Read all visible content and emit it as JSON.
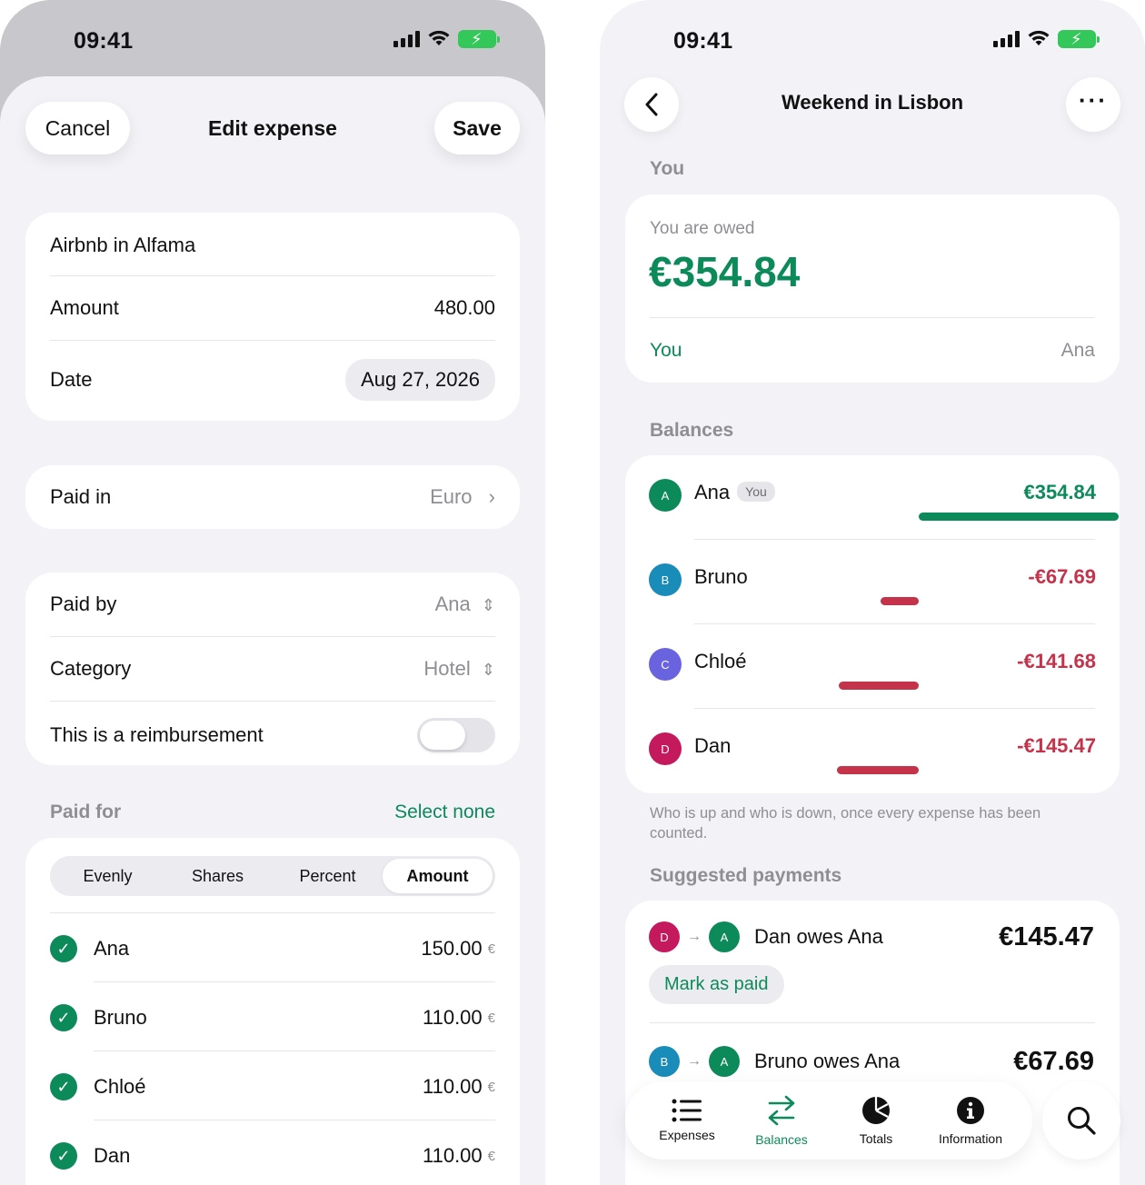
{
  "left": {
    "status": {
      "time": "09:41"
    },
    "header": {
      "cancel_label": "Cancel",
      "title": "Edit expense",
      "save_label": "Save"
    },
    "expense": {
      "title": "Airbnb in Alfama",
      "amount_label": "Amount",
      "amount_value": "480.00",
      "date_label": "Date",
      "date_value": "Aug 27, 2026"
    },
    "paid_in": {
      "label": "Paid in",
      "value": "Euro"
    },
    "details": {
      "paid_by_label": "Paid by",
      "paid_by_value": "Ana",
      "category_label": "Category",
      "category_value": "Hotel",
      "reimbursement_label": "This is a reimbursement",
      "reimbursement_on": false
    },
    "paid_for": {
      "label": "Paid for",
      "select_none": "Select none",
      "modes": [
        "Evenly",
        "Shares",
        "Percent",
        "Amount"
      ],
      "selected_mode": "Amount",
      "currency_symbol": "€",
      "people": [
        {
          "name": "Ana",
          "amount": "150.00",
          "checked": true
        },
        {
          "name": "Bruno",
          "amount": "110.00",
          "checked": true
        },
        {
          "name": "Chloé",
          "amount": "110.00",
          "checked": true
        },
        {
          "name": "Dan",
          "amount": "110.00",
          "checked": true
        }
      ]
    }
  },
  "right": {
    "status": {
      "time": "09:41"
    },
    "header": {
      "title": "Weekend in Lisbon"
    },
    "you": {
      "section": "You",
      "owed_label": "You are owed",
      "owed_amount": "€354.84",
      "left_name": "You",
      "right_name": "Ana"
    },
    "balances": {
      "section": "Balances",
      "you_badge": "You",
      "rows": [
        {
          "initial": "A",
          "name": "Ana",
          "amount": "€354.84",
          "value": 354.84,
          "color": "#0d8a5a"
        },
        {
          "initial": "B",
          "name": "Bruno",
          "amount": "-€67.69",
          "value": -67.69,
          "color": "#1a8cba"
        },
        {
          "initial": "C",
          "name": "Chloé",
          "amount": "-€141.68",
          "value": -141.68,
          "color": "#6a63e0"
        },
        {
          "initial": "D",
          "name": "Dan",
          "amount": "-€145.47",
          "value": -145.47,
          "color": "#c4195d"
        }
      ],
      "footnote": "Who is up and who is down, once every expense has been counted."
    },
    "suggested": {
      "section": "Suggested payments",
      "payments": [
        {
          "from_initial": "D",
          "to_initial": "A",
          "text": "Dan owes Ana",
          "amount": "€145.47",
          "action": "Mark as paid"
        },
        {
          "from_initial": "B",
          "to_initial": "A",
          "text": "Bruno owes Ana",
          "amount": "€67.69"
        }
      ]
    },
    "tabbar": {
      "tabs": [
        {
          "label": "Expenses",
          "icon": "list-icon"
        },
        {
          "label": "Balances",
          "icon": "arrows-icon",
          "active": true
        },
        {
          "label": "Totals",
          "icon": "pie-chart-icon"
        },
        {
          "label": "Information",
          "icon": "info-icon"
        }
      ]
    },
    "colors": {
      "positive": "#0d8a5a",
      "negative": "#c5334a",
      "accent": "#0d8a5a"
    }
  }
}
